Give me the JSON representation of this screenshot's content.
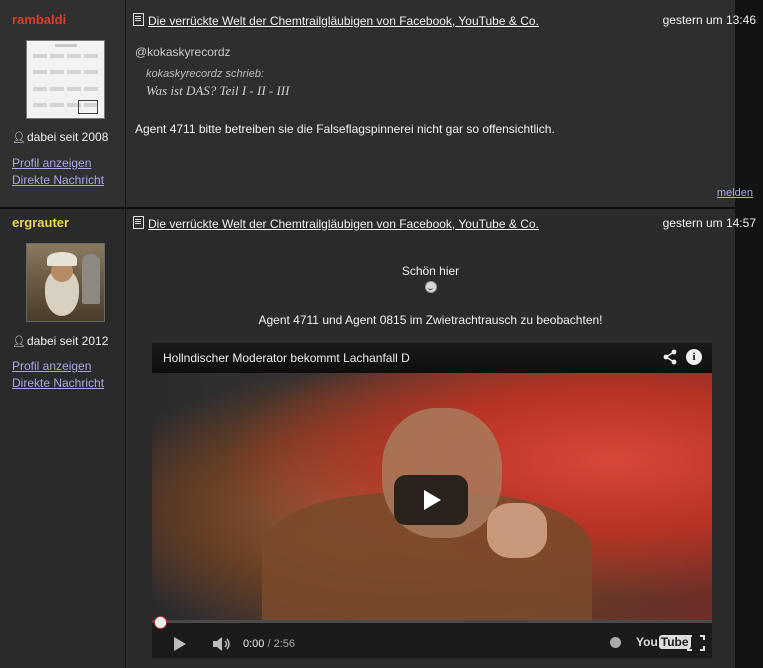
{
  "posts": [
    {
      "username": "rambaldi",
      "joined": "dabei seit 2008",
      "profile_link": "Profil anzeigen",
      "message_link": "Direkte Nachricht",
      "thread_title": "Die verrückte Welt der Chemtrailgläubigen von Facebook, YouTube & Co.",
      "timestamp": "gestern um 13:46",
      "mention": "@kokaskyrecordz",
      "quote_author": "kokaskyrecordz schrieb:",
      "quote_text": "Was ist DAS? Teil I - II - III",
      "body": "Agent 4711 bitte betreiben sie die Falseflagspinnerei nicht gar so offensichtlich.",
      "report_link": "melden"
    },
    {
      "username": "ergrauter",
      "joined": "dabei seit 2012",
      "profile_link": "Profil anzeigen",
      "message_link": "Direkte Nachricht",
      "thread_title": "Die verrückte Welt der Chemtrailgläubigen von Facebook, YouTube & Co.",
      "timestamp": "gestern um 14:57",
      "line1": "Schön hier",
      "line2": "Agent 4711 und Agent 0815 im Zwietrachtrausch zu beobachten!",
      "video": {
        "title": "Hollndischer Moderator bekommt Lachanfall D",
        "current_time": "0:00",
        "separator": " / ",
        "duration": "2:56",
        "logo_you": "You",
        "logo_tube": "Tube"
      }
    }
  ]
}
